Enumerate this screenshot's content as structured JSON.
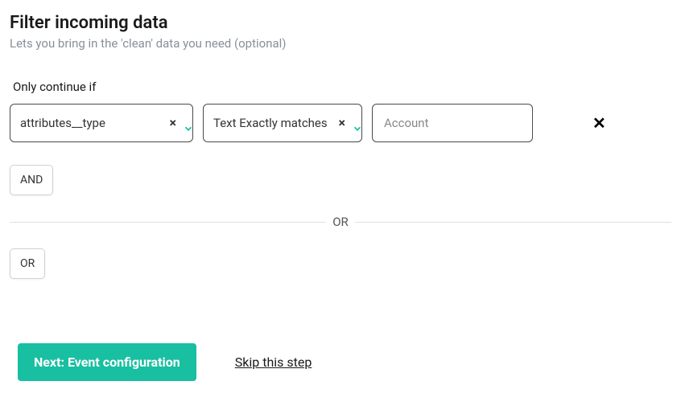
{
  "title": "Filter incoming data",
  "subtitle": "Lets you bring in the 'clean' data you need (optional)",
  "filter": {
    "label": "Only continue if",
    "field": "attributes__type",
    "operator": "Text Exactly matches",
    "value": "Account"
  },
  "buttons": {
    "and": "AND",
    "or_divider": "OR",
    "or": "OR",
    "next": "Next: Event configuration",
    "skip": "Skip this step"
  }
}
